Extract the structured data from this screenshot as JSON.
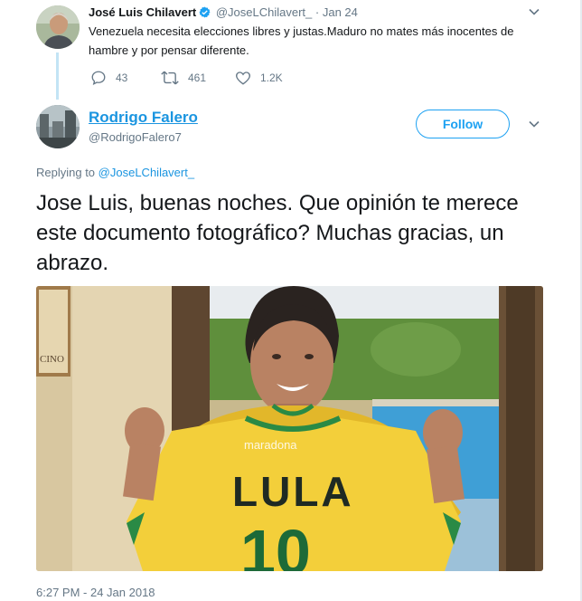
{
  "parent_tweet": {
    "author_name": "José Luis Chilavert",
    "handle": "@JoseLChilavert_",
    "separator": "·",
    "date": "Jan 24",
    "text": "Venezuela necesita elecciones libres y justas.Maduro no mates más inocentes de hambre y por pensar diferente.",
    "replies": "43",
    "retweets": "461",
    "likes": "1.2K"
  },
  "reply_tweet": {
    "author_name": "Rodrigo Falero",
    "handle": "@RodrigoFalero7",
    "follow_label": "Follow",
    "replying_prefix": "Replying to",
    "replying_to": "@JoseLChilavert_",
    "text": "Jose Luis, buenas noches. Que opinión te merece este documento fotográfico? Muchas gracias, un abrazo.",
    "photo": {
      "jersey_text": "LULA",
      "jersey_number": "10",
      "watermark": "maradona",
      "painting_text": "CINO"
    },
    "timestamp": "6:27 PM - 24 Jan 2018"
  },
  "colors": {
    "link_blue": "#1b95e0",
    "follow_blue": "#1da1f2",
    "secondary_text": "#657786",
    "thread_line": "#c3e4f5",
    "jersey_yellow": "#f3cf3a"
  },
  "icons": [
    "verified-badge-icon",
    "chevron-down-icon",
    "reply-icon",
    "retweet-icon",
    "like-icon"
  ]
}
